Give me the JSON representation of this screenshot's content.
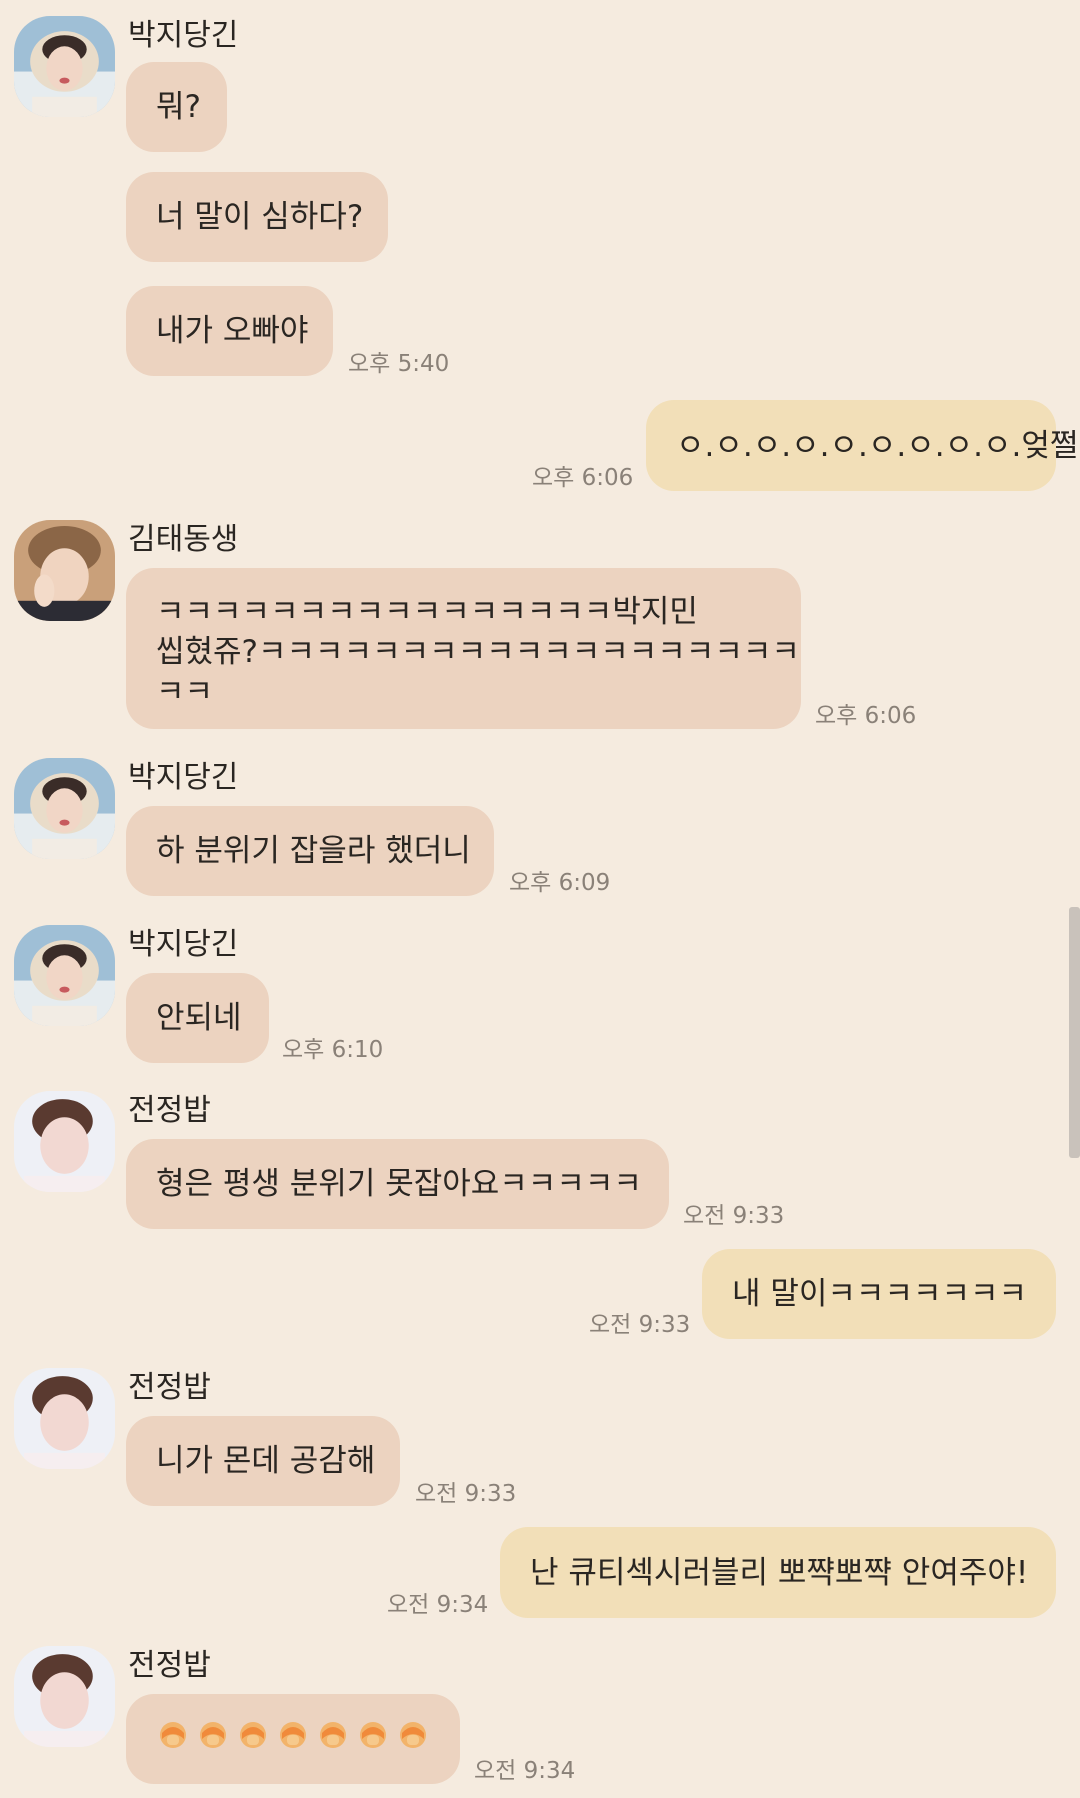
{
  "colors": {
    "background": "#f5ebdf",
    "incoming_bubble": "#ecd3c0",
    "outgoing_bubble": "#f2dfb8",
    "timestamp": "#8a8178"
  },
  "messages": [
    {
      "sender": "박지당긴",
      "lines": [
        "뭐?"
      ]
    },
    {
      "lines": [
        "너 말이 심하다?"
      ]
    },
    {
      "lines": [
        "내가 오빠야"
      ],
      "time": "오후 5:40"
    },
    {
      "outgoing": true,
      "lines": [
        "ㅇ.ㅇ.ㅇ.ㅇ.ㅇ.ㅇ.ㅇ.ㅇ.ㅇ.엊쩔"
      ],
      "time": "오후 6:06"
    },
    {
      "sender": "김태동생",
      "lines": [
        "ㅋㅋㅋㅋㅋㅋㅋㅋㅋㅋㅋㅋㅋㅋㅋㅋ박지민",
        "씹혔쥬?ㅋㅋㅋㅋㅋㅋㅋㅋㅋㅋㅋㅋㅋㅋㅋㅋㅋㅋㅋ",
        "ㅋㅋ"
      ],
      "time": "오후 6:06"
    },
    {
      "sender": "박지당긴",
      "lines": [
        "하 분위기 잡을라 했더니"
      ],
      "time": "오후 6:09"
    },
    {
      "sender": "박지당긴",
      "lines": [
        "안되네"
      ],
      "time": "오후 6:10"
    },
    {
      "sender": "전정밥",
      "lines": [
        "형은 평생 분위기 못잡아요ㅋㅋㅋㅋㅋ"
      ],
      "time": "오전 9:33"
    },
    {
      "outgoing": true,
      "lines": [
        "내 말이ㅋㅋㅋㅋㅋㅋㅋ"
      ],
      "time": "오전 9:33"
    },
    {
      "sender": "전정밥",
      "lines": [
        "니가 몬데 공감해"
      ],
      "time": "오전 9:33"
    },
    {
      "outgoing": true,
      "lines": [
        "난 큐티섹시러블리 뽀쨕뽀쨕 안여주야!"
      ],
      "time": "오전 9:34"
    },
    {
      "sender": "전정밥",
      "emoji": "person-facepalming x7",
      "time": "오전 9:34"
    }
  ]
}
